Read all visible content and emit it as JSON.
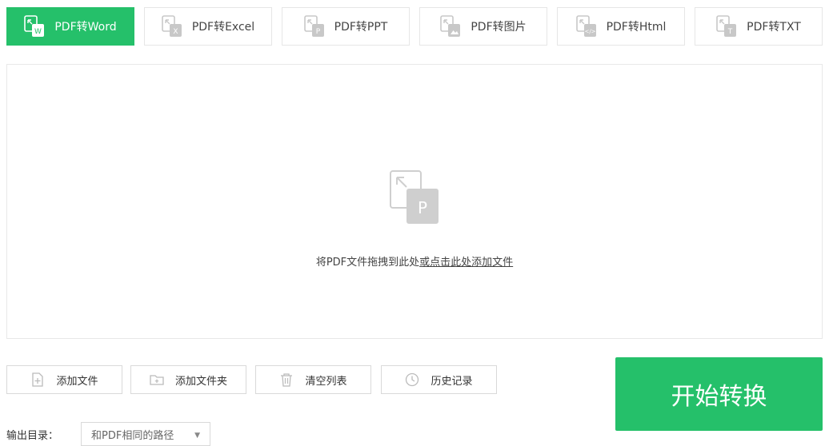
{
  "tabs": [
    {
      "label": "PDF转Word",
      "icon": "word-doc-icon",
      "active": true
    },
    {
      "label": "PDF转Excel",
      "icon": "excel-doc-icon",
      "active": false
    },
    {
      "label": "PDF转PPT",
      "icon": "ppt-doc-icon",
      "active": false
    },
    {
      "label": "PDF转图片",
      "icon": "image-doc-icon",
      "active": false
    },
    {
      "label": "PDF转Html",
      "icon": "html-doc-icon",
      "active": false
    },
    {
      "label": "PDF转TXT",
      "icon": "txt-doc-icon",
      "active": false
    }
  ],
  "dropzone": {
    "icon": "pdf-drop-icon",
    "text_plain": "将PDF文件拖拽到此处",
    "text_link": "或点击此处添加文件"
  },
  "actions": {
    "add_file": "添加文件",
    "add_folder": "添加文件夹",
    "clear_list": "清空列表",
    "history": "历史记录"
  },
  "start_button": "开始转换",
  "output": {
    "label": "输出目录：",
    "selected": "和PDF相同的路径"
  },
  "colors": {
    "accent": "#25c06a",
    "border": "#e6e6e6",
    "icon_gray": "#c8c8c8"
  }
}
